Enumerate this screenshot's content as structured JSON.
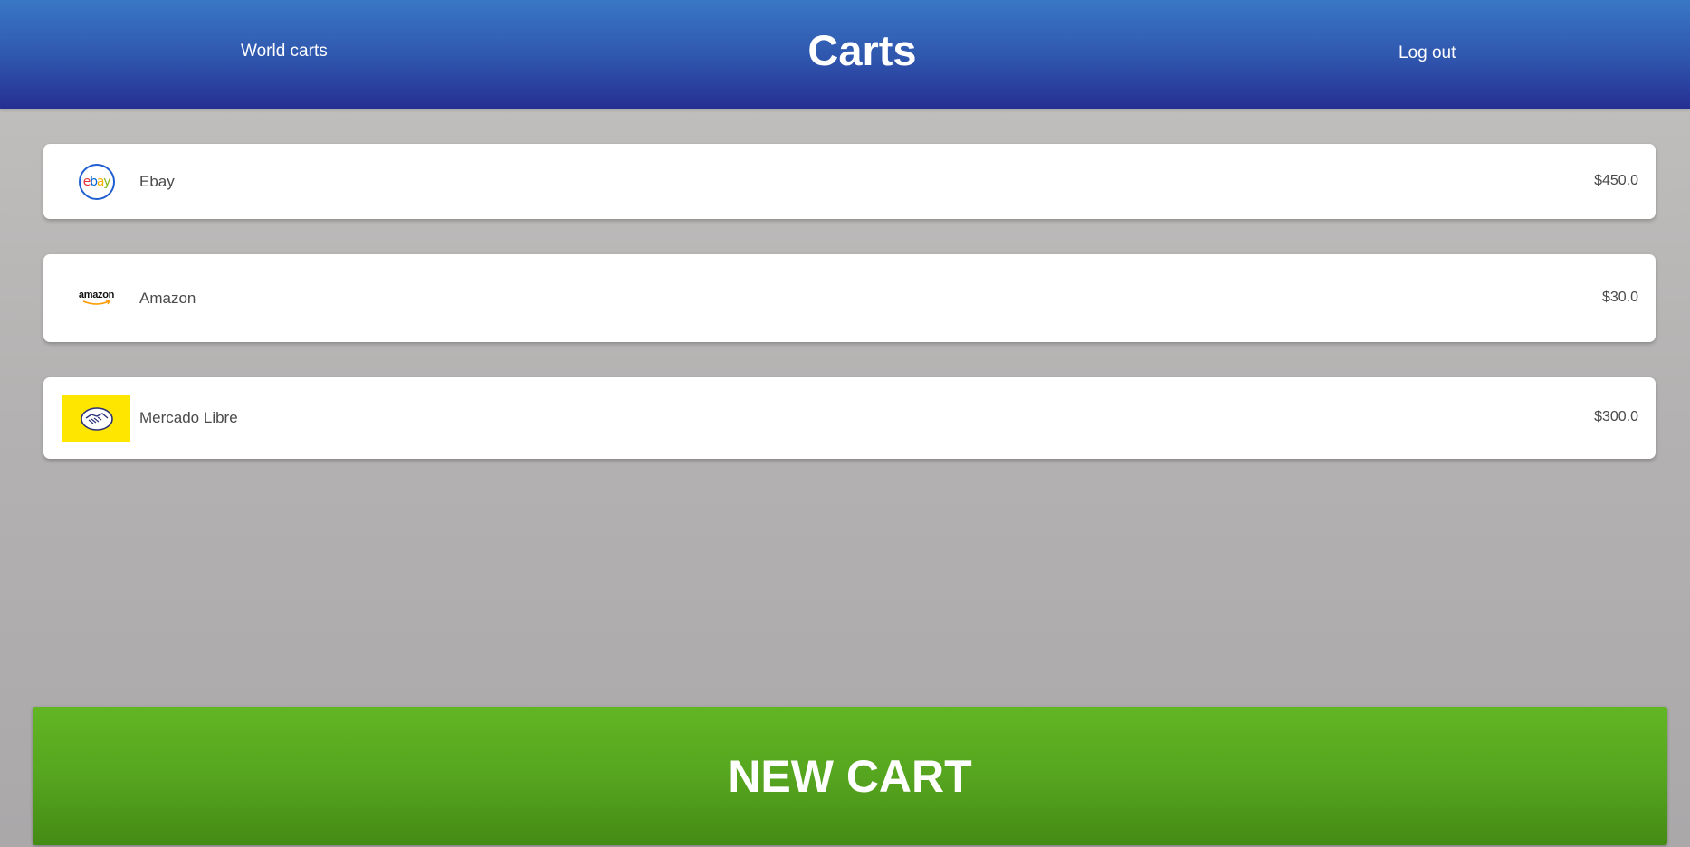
{
  "header": {
    "title": "Carts",
    "world_carts_label": "World carts",
    "logout_label": "Log out"
  },
  "carts": [
    {
      "name": "Ebay",
      "price": "$450.0",
      "logo": "ebay-logo",
      "logo_text": "ebay"
    },
    {
      "name": "Amazon",
      "price": "$30.0",
      "logo": "amazon-logo",
      "logo_text": "amazon"
    },
    {
      "name": "Mercado Libre",
      "price": "$300.0",
      "logo": "mercado-libre-logo"
    }
  ],
  "new_cart_label": "NEW CART",
  "colors": {
    "header_top": "#3977c4",
    "header_bottom": "#262f93",
    "button_green": "#56a51f",
    "ebay_red": "#e53238",
    "ebay_blue": "#0064d2",
    "ebay_yellow": "#f5af02",
    "ebay_green": "#86b817",
    "amazon_orange": "#ff9900",
    "mercado_yellow": "#ffe600"
  }
}
